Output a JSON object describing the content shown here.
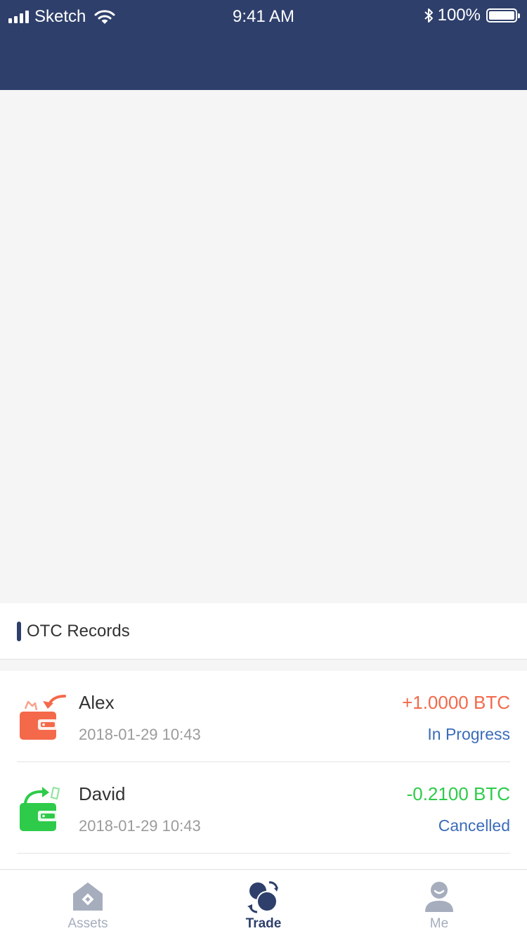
{
  "status_bar": {
    "carrier": "Sketch",
    "time": "9:41 AM",
    "battery": "100%"
  },
  "section": {
    "title": "OTC Records"
  },
  "records": [
    {
      "name": "Alex",
      "date": "2018-01-29 10:43",
      "amount": "+1.0000 BTC",
      "status": "In Progress",
      "icon": "wallet-receive-icon",
      "color": "#f4694a"
    },
    {
      "name": "David",
      "date": "2018-01-29 10:43",
      "amount": "-0.2100 BTC",
      "status": "Cancelled",
      "icon": "wallet-send-icon",
      "color": "#2ecb4a"
    }
  ],
  "tabbar": {
    "tabs": [
      {
        "label": "Assets",
        "icon": "home-icon",
        "active": false
      },
      {
        "label": "Trade",
        "icon": "trade-exchange-icon",
        "active": true
      },
      {
        "label": "Me",
        "icon": "user-icon",
        "active": false
      }
    ]
  },
  "colors": {
    "primary": "#2e3f6b",
    "accent_blue": "#3b6cb8",
    "positive": "#f4694a",
    "negative": "#2ecb4a"
  }
}
